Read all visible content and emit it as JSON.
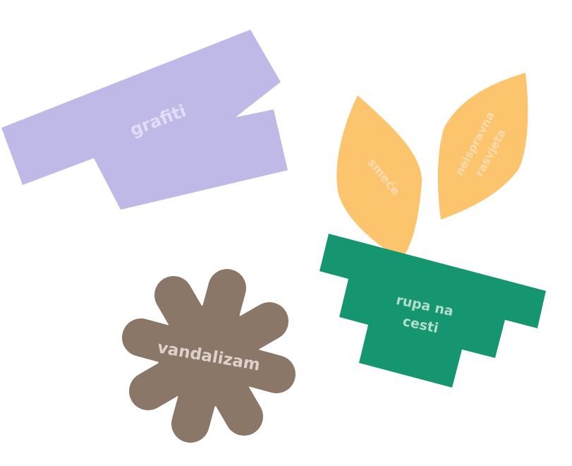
{
  "labels": {
    "grafiti": "grafiti",
    "smece": "smeće",
    "rasvjeta_line1": "neispravna",
    "rasvjeta_line2": "rasvjeta",
    "rupa_line1": "rupa na",
    "rupa_line2": "cesti",
    "vandalizam": "vandalizam"
  },
  "colors": {
    "lavender": "#bfb9e8",
    "orange": "#fcc56d",
    "green": "#169670",
    "brown": "#8b7768",
    "label_lavender": "#e2dcf6",
    "label_orange": "#fbdcb2",
    "label_green": "#b4ddcb",
    "label_brown": "#dcd1cb"
  }
}
